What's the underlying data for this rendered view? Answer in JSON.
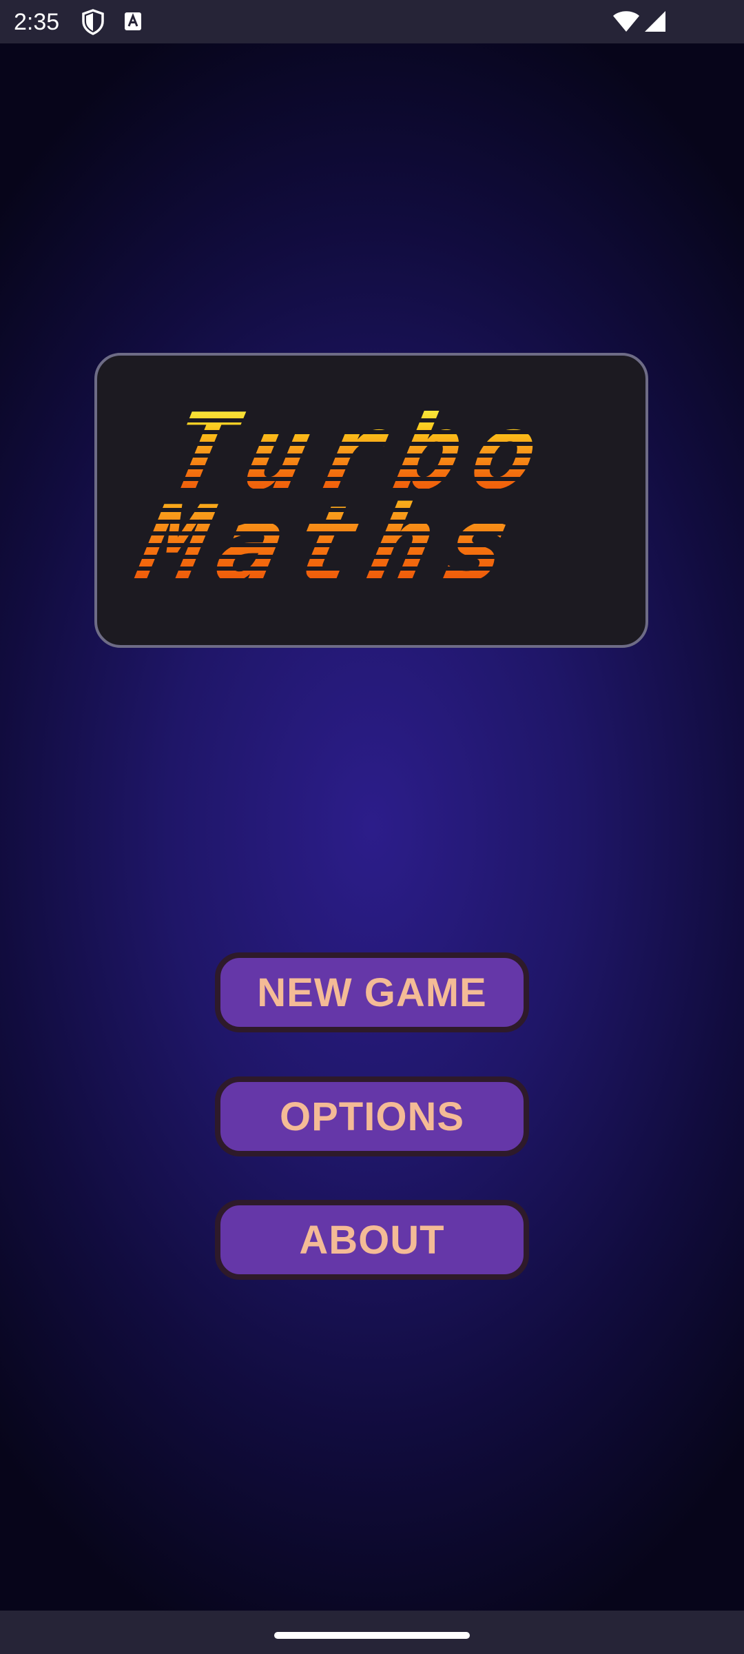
{
  "status_bar": {
    "time": "2:35",
    "icons": [
      "shield-icon",
      "accessibility-a-icon",
      "wifi-icon",
      "cell-signal-icon"
    ]
  },
  "logo": {
    "line1": "Turbo",
    "line2": "Maths",
    "gradient_colors": [
      "#f8e63a",
      "#fbc319",
      "#f8971a",
      "#f4700f",
      "#ef5a0a"
    ]
  },
  "menu": {
    "new_game": "NEW GAME",
    "options": "OPTIONS",
    "about": "ABOUT"
  },
  "colors": {
    "button_fill": "#6537a8",
    "button_border": "#2e1a2a",
    "button_text": "#f4bb96",
    "background_center": "#2c1d8a",
    "background_edge": "#07051a"
  }
}
